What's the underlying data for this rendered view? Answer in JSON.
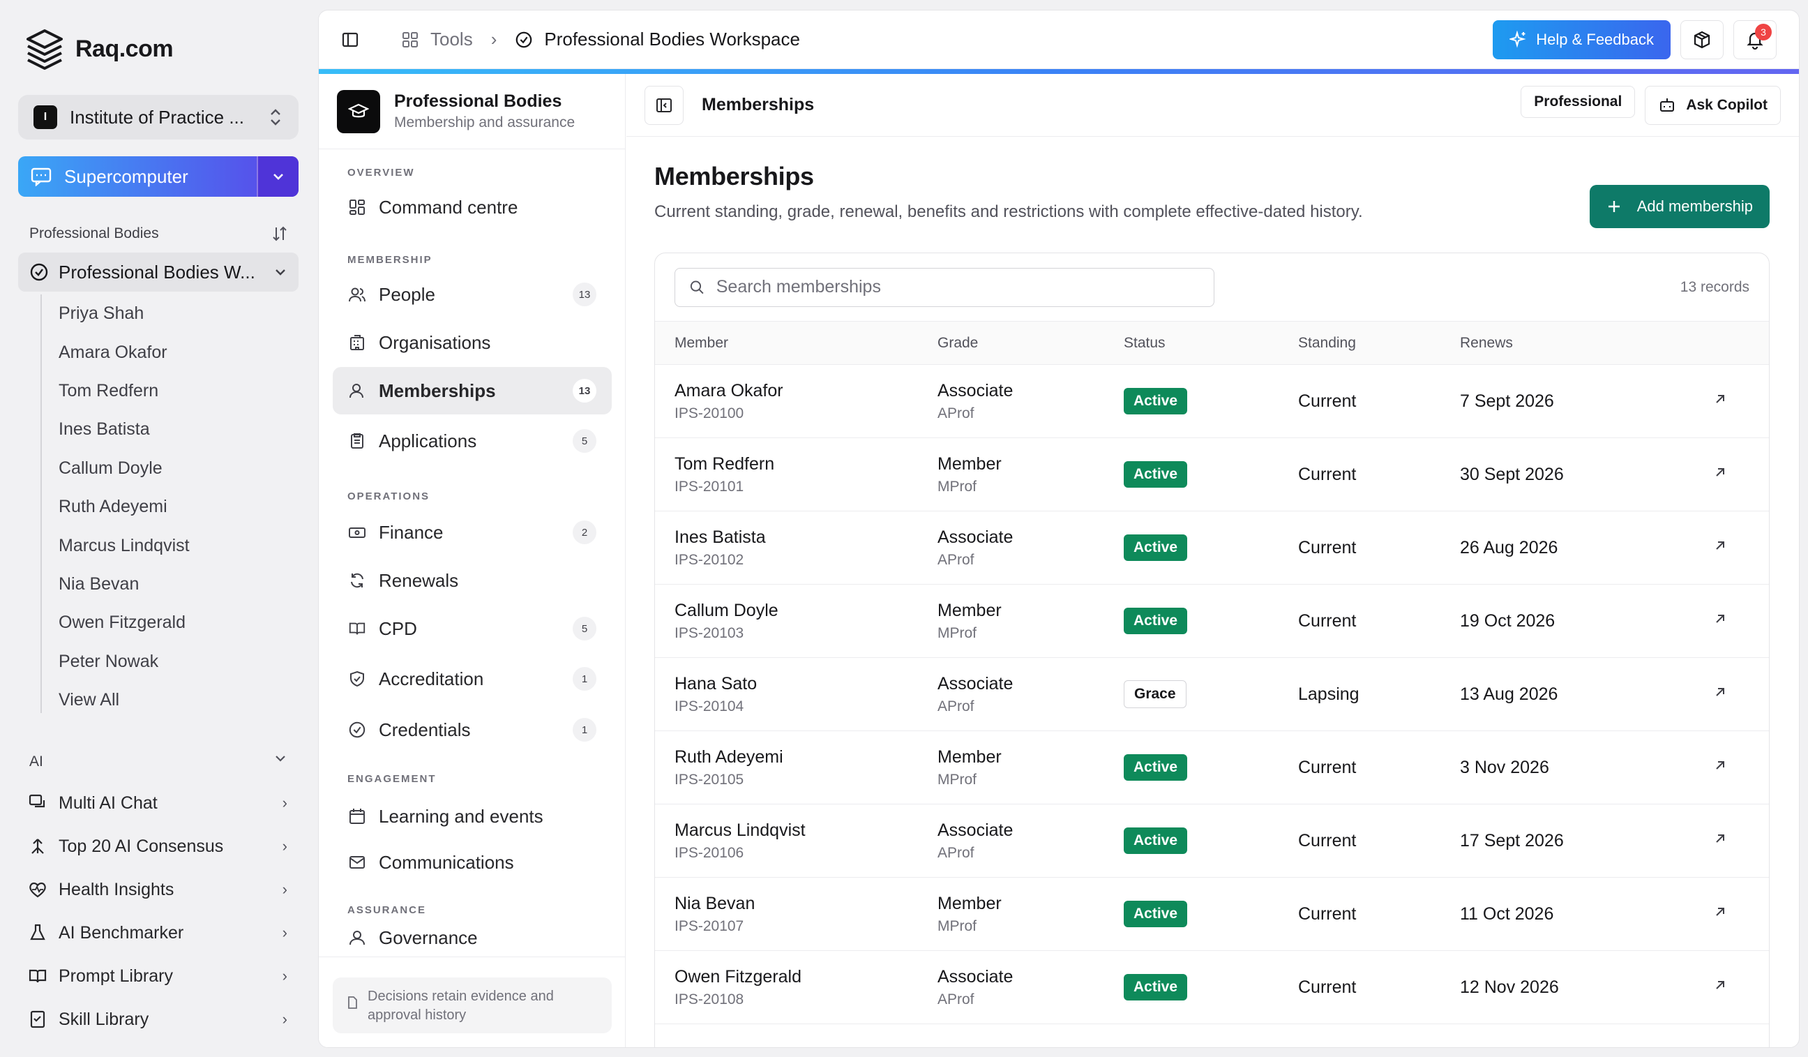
{
  "brand": {
    "name": "Raq.com"
  },
  "org": {
    "badge": "I",
    "name": "Institute of Practice ..."
  },
  "supercomputer": {
    "label": "Supercomputer"
  },
  "sidebar": {
    "section_title": "Professional Bodies",
    "workspace_label": "Professional Bodies W...",
    "sub_items": [
      "Priya Shah",
      "Amara Okafor",
      "Tom Redfern",
      "Ines Batista",
      "Callum Doyle",
      "Ruth Adeyemi",
      "Marcus Lindqvist",
      "Nia Bevan",
      "Owen Fitzgerald",
      "Peter Nowak",
      "View All"
    ],
    "ai_section": "AI",
    "ai_items": [
      "Multi AI Chat",
      "Top 20 AI Consensus",
      "Health Insights",
      "AI Benchmarker",
      "Prompt Library",
      "Skill Library"
    ]
  },
  "topbar": {
    "tools": "Tools",
    "current": "Professional Bodies Workspace",
    "help": "Help & Feedback",
    "notifications": "3"
  },
  "module": {
    "title": "Professional Bodies",
    "subtitle": "Membership and assurance",
    "sections": {
      "overview": "OVERVIEW",
      "membership": "MEMBERSHIP",
      "operations": "OPERATIONS",
      "engagement": "ENGAGEMENT",
      "assurance": "ASSURANCE"
    },
    "items": {
      "command": "Command centre",
      "people": {
        "label": "People",
        "count": "13"
      },
      "organisations": "Organisations",
      "memberships": {
        "label": "Memberships",
        "count": "13"
      },
      "applications": {
        "label": "Applications",
        "count": "5"
      },
      "finance": {
        "label": "Finance",
        "count": "2"
      },
      "renewals": "Renewals",
      "cpd": {
        "label": "CPD",
        "count": "5"
      },
      "accreditation": {
        "label": "Accreditation",
        "count": "1"
      },
      "credentials": {
        "label": "Credentials",
        "count": "1"
      },
      "learning": "Learning and events",
      "communications": "Communications",
      "governance": "Governance"
    },
    "footer": "Decisions retain evidence and approval history"
  },
  "content": {
    "bar_title": "Memberships",
    "plan": "Professional",
    "copilot": "Ask Copilot",
    "title": "Memberships",
    "description": "Current standing, grade, renewal, benefits and restrictions with complete effective-dated history.",
    "add_button": "Add membership",
    "search_placeholder": "Search memberships",
    "records": "13 records",
    "columns": [
      "Member",
      "Grade",
      "Status",
      "Standing",
      "Renews"
    ],
    "rows": [
      {
        "name": "Amara Okafor",
        "id": "IPS-20100",
        "grade": "Associate",
        "grade_code": "AProf",
        "status": "Active",
        "standing": "Current",
        "renews": "7 Sept 2026"
      },
      {
        "name": "Tom Redfern",
        "id": "IPS-20101",
        "grade": "Member",
        "grade_code": "MProf",
        "status": "Active",
        "standing": "Current",
        "renews": "30 Sept 2026"
      },
      {
        "name": "Ines Batista",
        "id": "IPS-20102",
        "grade": "Associate",
        "grade_code": "AProf",
        "status": "Active",
        "standing": "Current",
        "renews": "26 Aug 2026"
      },
      {
        "name": "Callum Doyle",
        "id": "IPS-20103",
        "grade": "Member",
        "grade_code": "MProf",
        "status": "Active",
        "standing": "Current",
        "renews": "19 Oct 2026"
      },
      {
        "name": "Hana Sato",
        "id": "IPS-20104",
        "grade": "Associate",
        "grade_code": "AProf",
        "status": "Grace",
        "standing": "Lapsing",
        "renews": "13 Aug 2026"
      },
      {
        "name": "Ruth Adeyemi",
        "id": "IPS-20105",
        "grade": "Member",
        "grade_code": "MProf",
        "status": "Active",
        "standing": "Current",
        "renews": "3 Nov 2026"
      },
      {
        "name": "Marcus Lindqvist",
        "id": "IPS-20106",
        "grade": "Associate",
        "grade_code": "AProf",
        "status": "Active",
        "standing": "Current",
        "renews": "17 Sept 2026"
      },
      {
        "name": "Nia Bevan",
        "id": "IPS-20107",
        "grade": "Member",
        "grade_code": "MProf",
        "status": "Active",
        "standing": "Current",
        "renews": "11 Oct 2026"
      },
      {
        "name": "Owen Fitzgerald",
        "id": "IPS-20108",
        "grade": "Associate",
        "grade_code": "AProf",
        "status": "Active",
        "standing": "Current",
        "renews": "12 Nov 2026"
      }
    ]
  },
  "colors": {
    "accent": "#0e7a68",
    "active_status": "#0e8a5a",
    "help_gradient_start": "#1e9bf0",
    "help_gradient_end": "#3a66ee"
  }
}
